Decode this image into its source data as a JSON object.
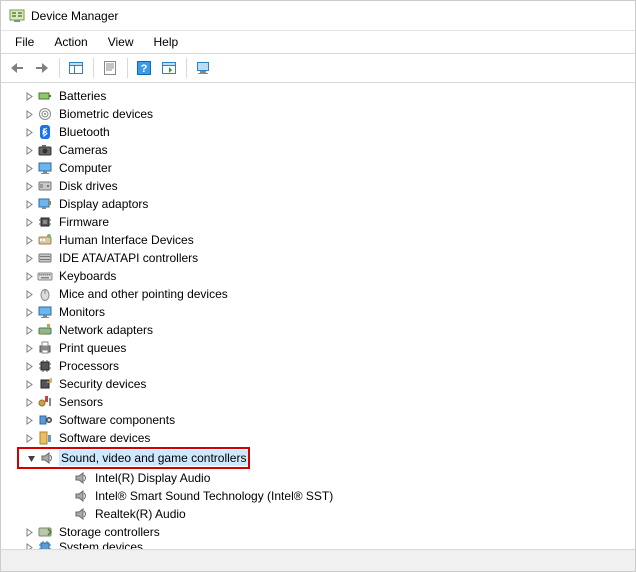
{
  "title": "Device Manager",
  "menu": {
    "file": "File",
    "action": "Action",
    "view": "View",
    "help": "Help"
  },
  "tree": {
    "items": [
      {
        "label": "Batteries",
        "icon": "battery"
      },
      {
        "label": "Biometric devices",
        "icon": "fingerprint"
      },
      {
        "label": "Bluetooth",
        "icon": "bluetooth"
      },
      {
        "label": "Cameras",
        "icon": "camera"
      },
      {
        "label": "Computer",
        "icon": "monitor"
      },
      {
        "label": "Disk drives",
        "icon": "disk"
      },
      {
        "label": "Display adaptors",
        "icon": "display-adapter"
      },
      {
        "label": "Firmware",
        "icon": "chip"
      },
      {
        "label": "Human Interface Devices",
        "icon": "hid"
      },
      {
        "label": "IDE ATA/ATAPI controllers",
        "icon": "ide"
      },
      {
        "label": "Keyboards",
        "icon": "keyboard"
      },
      {
        "label": "Mice and other pointing devices",
        "icon": "mouse"
      },
      {
        "label": "Monitors",
        "icon": "monitor"
      },
      {
        "label": "Network adapters",
        "icon": "network"
      },
      {
        "label": "Print queues",
        "icon": "printer"
      },
      {
        "label": "Processors",
        "icon": "cpu"
      },
      {
        "label": "Security devices",
        "icon": "security"
      },
      {
        "label": "Sensors",
        "icon": "sensor"
      },
      {
        "label": "Software components",
        "icon": "sw-component"
      },
      {
        "label": "Software devices",
        "icon": "sw-device"
      },
      {
        "label": "Sound, video and game controllers",
        "icon": "speaker",
        "expanded": true,
        "selected": true,
        "highlighted": true,
        "children": [
          {
            "label": "Intel(R) Display Audio",
            "icon": "speaker"
          },
          {
            "label": "Intel® Smart Sound Technology (Intel® SST)",
            "icon": "speaker"
          },
          {
            "label": "Realtek(R) Audio",
            "icon": "speaker"
          }
        ]
      },
      {
        "label": "Storage controllers",
        "icon": "storage"
      },
      {
        "label": "System devices",
        "icon": "system",
        "cut": true
      }
    ]
  }
}
